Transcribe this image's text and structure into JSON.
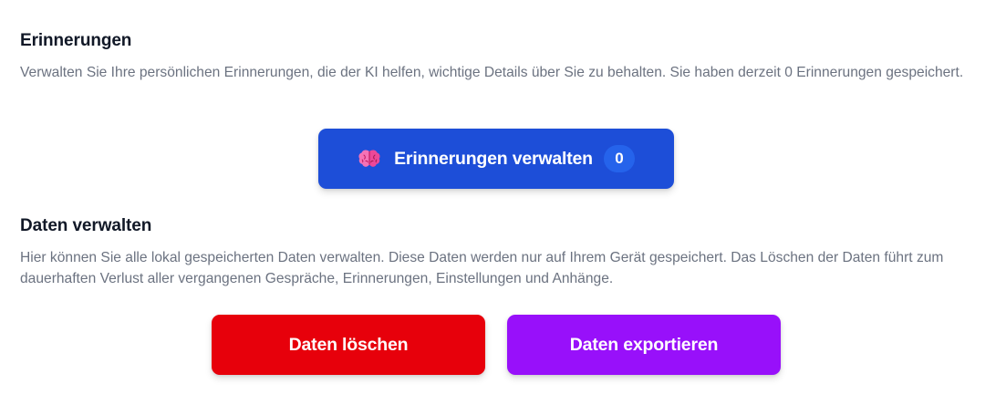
{
  "colors": {
    "primary_button": "#1d4ed8",
    "danger_button": "#e7000b",
    "export_button": "#9810fa",
    "badge_bg": "#2563eb",
    "title_text": "#111827",
    "description_text": "#6b7280",
    "icon_pink": "#f472b6"
  },
  "memories": {
    "title": "Erinnerungen",
    "description": "Verwalten Sie Ihre persönlichen Erinnerungen, die der KI helfen, wichtige Details über Sie zu behalten. Sie haben derzeit 0 Erinnerungen gespeichert.",
    "manage_button_label": "Erinnerungen verwalten",
    "manage_button_icon": "brain-icon",
    "count": "0"
  },
  "data_management": {
    "title": "Daten verwalten",
    "description": "Hier können Sie alle lokal gespeicherten Daten verwalten. Diese Daten werden nur auf Ihrem Gerät gespeichert. Das Löschen der Daten führt zum dauerhaften Verlust aller vergangenen Gespräche, Erinnerungen, Einstellungen und Anhänge.",
    "delete_button_label": "Daten löschen",
    "export_button_label": "Daten exportieren"
  }
}
